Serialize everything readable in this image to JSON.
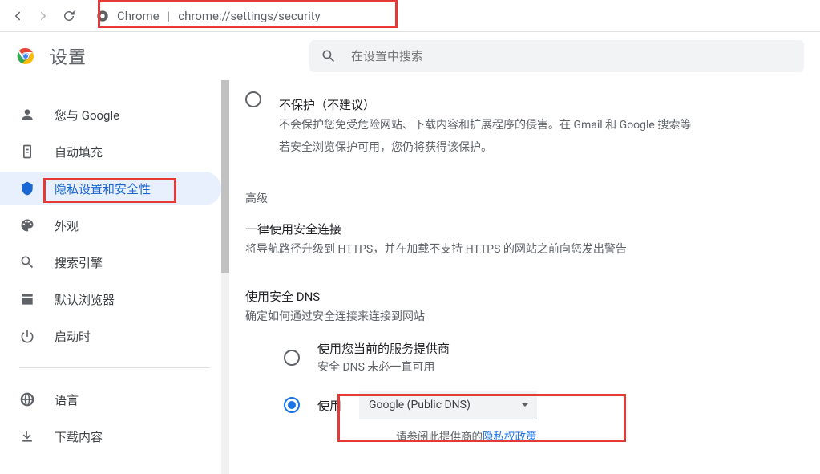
{
  "toolbar": {
    "url_host": "Chrome",
    "url_path": "chrome://settings/security"
  },
  "header": {
    "title": "设置",
    "search_placeholder": "在设置中搜索"
  },
  "sidebar": {
    "items": [
      {
        "key": "you-and-google",
        "label": "您与 Google"
      },
      {
        "key": "autofill",
        "label": "自动填充"
      },
      {
        "key": "privacy",
        "label": "隐私设置和安全性",
        "active": true
      },
      {
        "key": "appearance",
        "label": "外观"
      },
      {
        "key": "search-engine",
        "label": "搜索引擎"
      },
      {
        "key": "default-browser",
        "label": "默认浏览器"
      },
      {
        "key": "on-startup",
        "label": "启动时"
      },
      {
        "key": "languages",
        "label": "语言"
      },
      {
        "key": "downloads",
        "label": "下载内容"
      }
    ]
  },
  "content": {
    "no_protect_title": "不保护（不建议）",
    "no_protect_desc1": "不会保护您免受危险网站、下载内容和扩展程序的侵害。在 Gmail 和 Google 搜索等",
    "no_protect_desc2": "若安全浏览保护可用，您仍将获得该保护。",
    "advanced_label": "高级",
    "https_title": "一律使用安全连接",
    "https_desc": "将导航路径升级到 HTTPS，并在加载不支持 HTTPS 的网站之前向您发出警告",
    "dns_title": "使用安全 DNS",
    "dns_desc": "确定如何通过安全连接来连接到网站",
    "dns_current_label": "使用您当前的服务提供商",
    "dns_current_sub": "安全 DNS 未必一直可用",
    "dns_use_label": "使用",
    "dns_provider": "Google (Public DNS)",
    "policy_prefix": "请参阅此提供商的",
    "policy_link": "隐私权政策"
  }
}
